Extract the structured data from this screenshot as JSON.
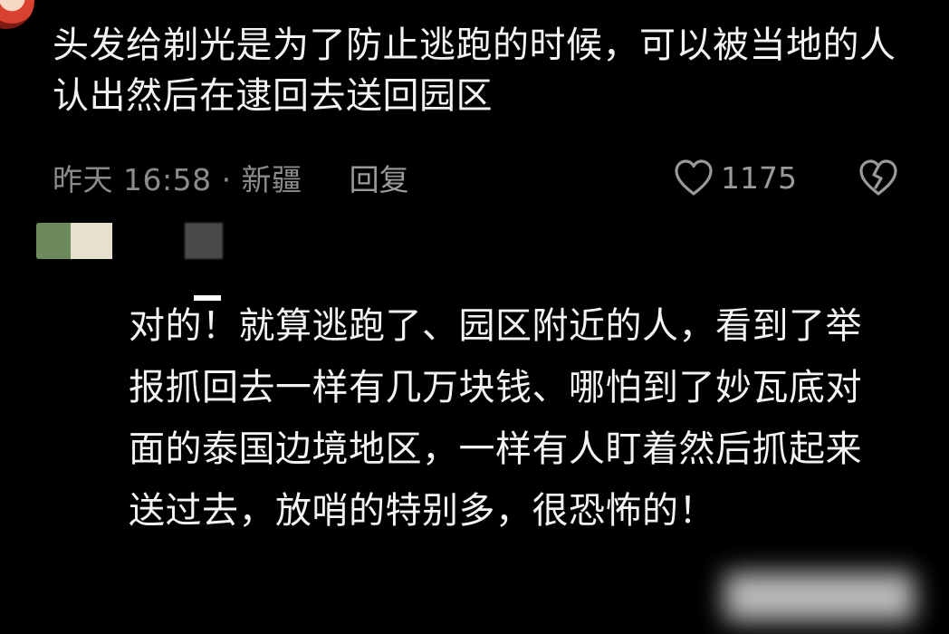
{
  "top_comment": {
    "text": "头发给剃光是为了防止逃跑的时候，可以被当地的人认出然后在逮回去送回园区",
    "time_location": "昨天 16:58 · 新疆",
    "reply_label": "回复",
    "like_count": "1175",
    "like_icon": "heart-outline-icon",
    "dislike_icon": "broken-heart-icon"
  },
  "reply_comment": {
    "text": "对的！就算逃跑了、园区附近的人，看到了举报抓回去一样有几万块钱、哪怕到了妙瓦底对面的泰国边境地区，一样有人盯着然后抓起来送过去，放哨的特别多，很恐怖的！"
  }
}
